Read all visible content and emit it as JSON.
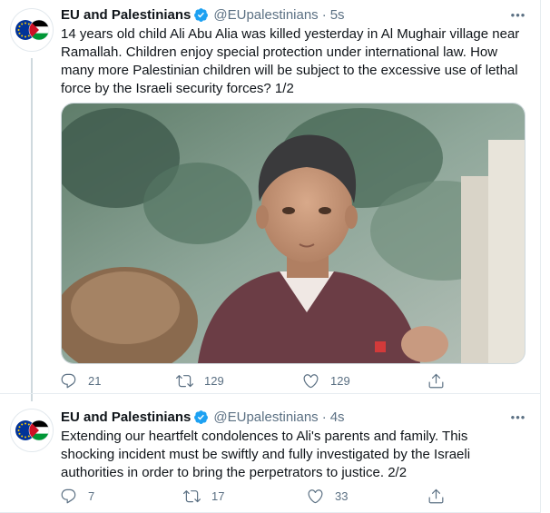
{
  "tweets": [
    {
      "author_name": "EU and Palestinians",
      "handle": "@EUpalestinians",
      "separator": "·",
      "time": "5s",
      "text": "14 years old child Ali Abu Alia was killed yesterday in Al Mughair village near Ramallah. Children enjoy special protection under international law. How many more  Palestinian children will be subject to the excessive use of lethal force by the Israeli security forces? 1/2",
      "replies": "21",
      "retweets": "129",
      "likes": "129"
    },
    {
      "author_name": "EU and Palestinians",
      "handle": "@EUpalestinians",
      "separator": "·",
      "time": "4s",
      "text": "Extending our heartfelt condolences to Ali's parents and family. This shocking incident must be swiftly and fully investigated by the Israeli authorities in order to bring the perpetrators to justice. 2/2",
      "replies": "7",
      "retweets": "17",
      "likes": "33"
    }
  ],
  "icons": {
    "more": "more-icon",
    "reply": "reply-icon",
    "retweet": "retweet-icon",
    "like": "like-icon",
    "share": "share-icon",
    "verified": "verified-icon"
  },
  "colors": {
    "verified_blue": "#1da1f2",
    "muted_text": "#5b7083",
    "eu_blue": "#003399",
    "eu_star": "#ffcc00",
    "ps_red": "#ce1126",
    "ps_green": "#009736"
  }
}
